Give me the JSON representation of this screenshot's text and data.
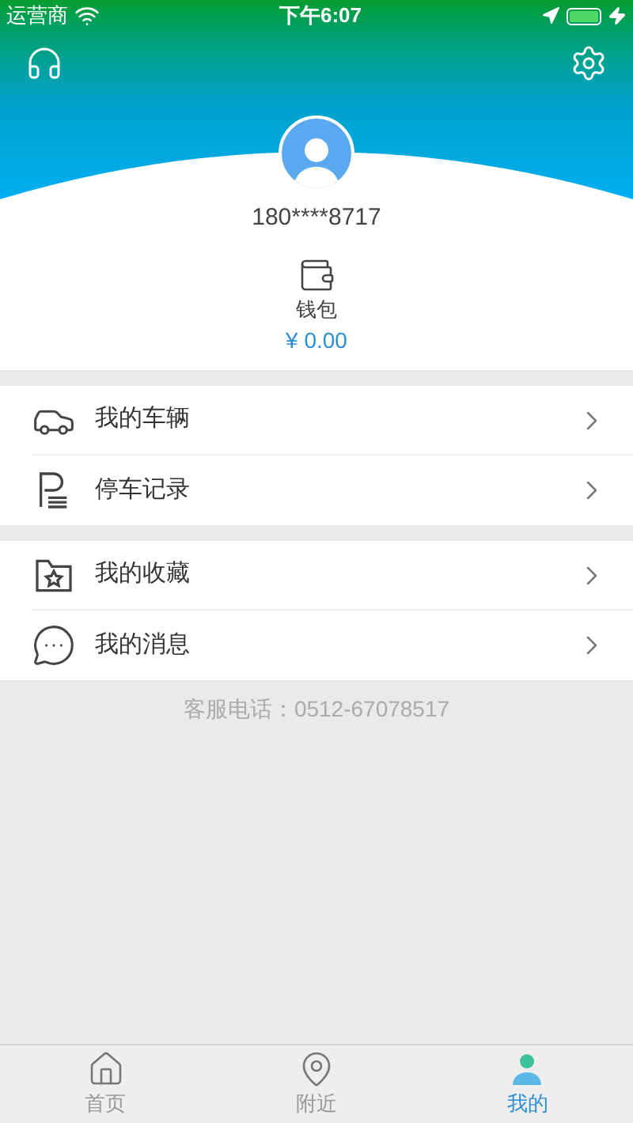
{
  "status_bar": {
    "carrier": "运营商",
    "time": "下午6:07"
  },
  "profile": {
    "phone": "180****8717"
  },
  "wallet": {
    "label": "钱包",
    "balance": "¥ 0.00"
  },
  "menu_groups": [
    [
      {
        "kind": "car",
        "label": "我的车辆"
      },
      {
        "kind": "parking",
        "label": "停车记录"
      }
    ],
    [
      {
        "kind": "favorites",
        "label": "我的收藏"
      },
      {
        "kind": "messages",
        "label": "我的消息"
      }
    ]
  ],
  "service_phone": "客服电话：0512-67078517",
  "tabs": [
    {
      "kind": "home",
      "label": "首页",
      "selected": false
    },
    {
      "kind": "nearby",
      "label": "附近",
      "selected": false
    },
    {
      "kind": "me",
      "label": "我的",
      "selected": true
    }
  ]
}
